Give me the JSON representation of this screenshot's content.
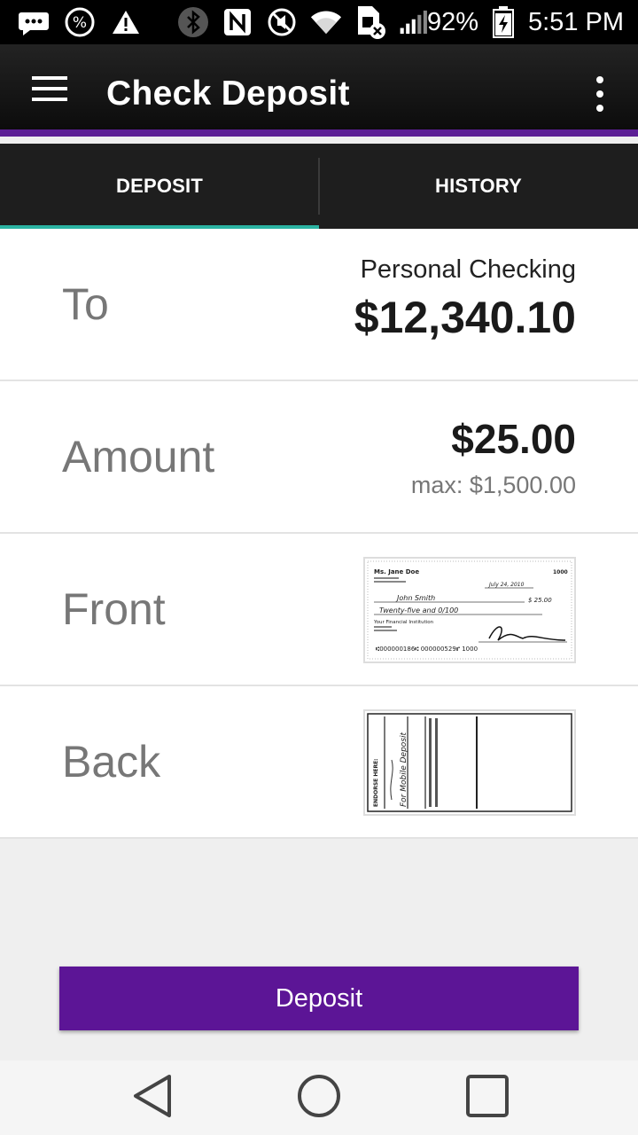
{
  "status_bar": {
    "battery_percent": "92%",
    "time": "5:51 PM"
  },
  "app_bar": {
    "title": "Check Deposit"
  },
  "tabs": [
    {
      "label": "DEPOSIT",
      "selected": true
    },
    {
      "label": "HISTORY",
      "selected": false
    }
  ],
  "deposit_form": {
    "to": {
      "label": "To",
      "account_name": "Personal Checking",
      "balance": "$12,340.10"
    },
    "amount": {
      "label": "Amount",
      "value": "$25.00",
      "max": "max: $1,500.00"
    },
    "front": {
      "label": "Front",
      "check": {
        "name": "Ms. Jane Doe",
        "number": "1000",
        "date": "July 24, 2010",
        "payee": "John Smith",
        "amount": "$ 25.00",
        "written_amount": "Twenty-five and 0/100",
        "bank": "Your Financial Institution",
        "micr": "⑆000000186⑆ 000000529⑈ 1000"
      }
    },
    "back": {
      "label": "Back",
      "endorse_text": "ENDORSE HERE:",
      "mobile_text": "For Mobile Deposit"
    }
  },
  "deposit_button": {
    "label": "Deposit"
  },
  "colors": {
    "accent_purple": "#5c1596",
    "tab_indicator": "#2bb3a2",
    "app_bar": "#151515"
  }
}
